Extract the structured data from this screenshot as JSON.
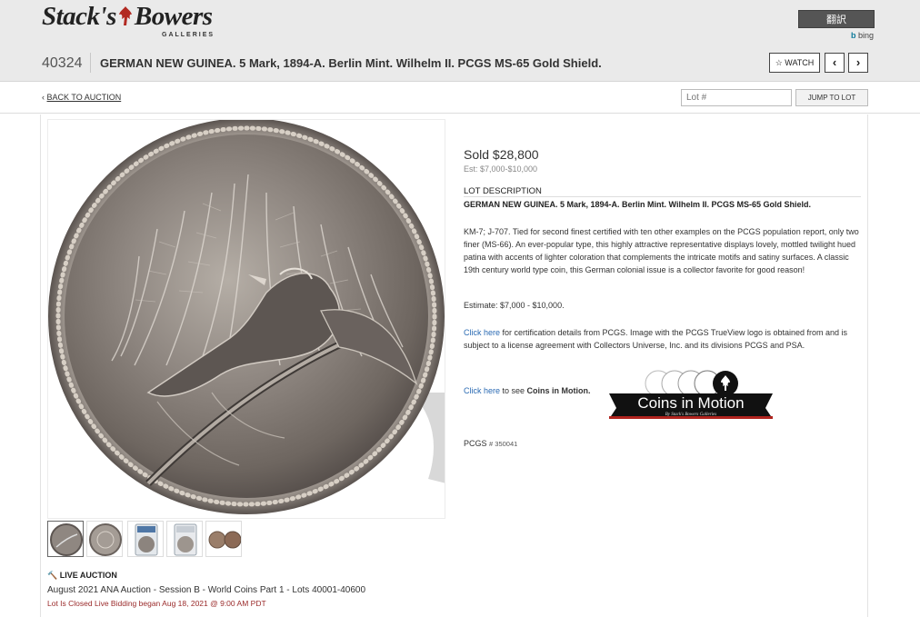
{
  "header": {
    "logo_text": "Stack's Bowers",
    "logo_sub": "GALLERIES",
    "translate_label": "翻訳",
    "bing_label": "bing"
  },
  "lot": {
    "number": "40324",
    "title": "GERMAN NEW GUINEA. 5 Mark, 1894-A. Berlin Mint. Wilhelm II. PCGS MS-65 Gold Shield.",
    "watch_label": "WATCH",
    "prev_label": "‹",
    "next_label": "›"
  },
  "subbar": {
    "back_label": "BACK TO AUCTION",
    "lot_placeholder": "Lot #",
    "jump_label": "JUMP TO LOT"
  },
  "sale": {
    "sold": "Sold $28,800",
    "est": "Est: $7,000-$10,000"
  },
  "description": {
    "heading": "LOT DESCRIPTION",
    "title": "GERMAN NEW GUINEA. 5 Mark, 1894-A. Berlin Mint. Wilhelm II. PCGS MS-65 Gold Shield.",
    "body": "KM-7; J-707. Tied for second finest certified with ten other examples on the PCGS population report, only two finer (MS-66). An ever-popular type, this highly attractive representative displays lovely, mottled twilight hued patina with accents of lighter coloration that complements the intricate motifs and satiny surfaces. A classic 19th century world type coin, this German colonial issue is a collector favorite for good reason!",
    "estimate": "Estimate: $7,000 - $10,000.",
    "cert_link": "Click here",
    "cert_text": " for certification details from PCGS. Image with the PCGS TrueView logo is obtained from and is subject to a license agreement with Collectors Universe, Inc. and its divisions PCGS and PSA.",
    "cim_link": "Click here",
    "cim_pre": " to see ",
    "cim_bold": "Coins in Motion.",
    "cim_logo_title": "Coins in Motion",
    "cim_logo_sub": "By Stack's Bowers Galleries",
    "pcgs_label": "PCGS",
    "pcgs_number": "# 350041"
  },
  "auction": {
    "live_label": "LIVE AUCTION",
    "session": "August 2021 ANA Auction - Session B - World Coins Part 1 - Lots 40001-40600",
    "closed": "Lot Is Closed Live Bidding began Aug 18, 2021 @ 9:00 AM PDT"
  },
  "icons": {
    "star": "star-icon",
    "chevron_left": "chevron-left-icon",
    "chevron_right": "chevron-right-icon",
    "hammer": "gavel-icon",
    "back": "chevron-left-icon"
  },
  "colors": {
    "topbar": "#eaeaea",
    "link": "#2a6ab3",
    "closed": "#9a2a2a",
    "translate_btn": "#555555"
  }
}
